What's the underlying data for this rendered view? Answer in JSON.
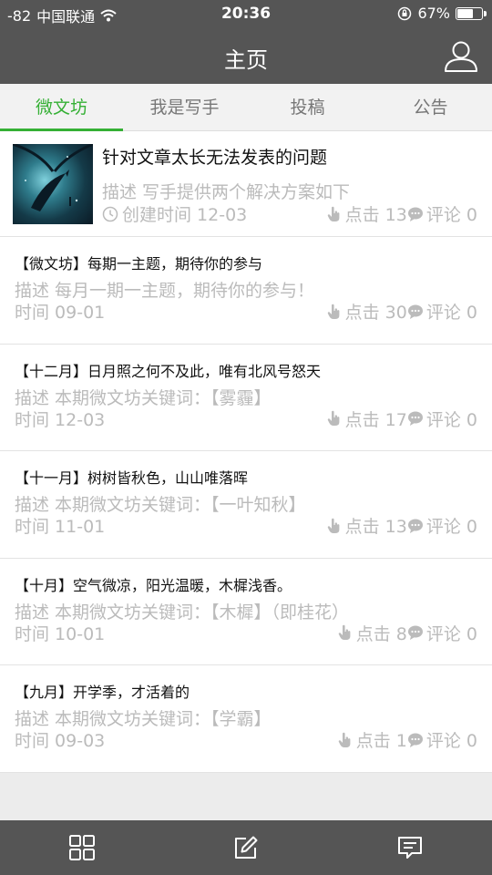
{
  "status_bar": {
    "signal": "-82",
    "carrier": "中国联通",
    "time": "20:36",
    "battery": "67%",
    "battery_level": 0.67
  },
  "header": {
    "title": "主页"
  },
  "tabs": [
    {
      "label": "微文坊",
      "active": true
    },
    {
      "label": "我是写手",
      "active": false
    },
    {
      "label": "投稿",
      "active": false
    },
    {
      "label": "公告",
      "active": false
    }
  ],
  "featured": {
    "title": "针对文章太长无法发表的问题",
    "desc": "描述 写手提供两个解决方案如下",
    "time": "创建时间 12-03",
    "clicks": "点击 13",
    "comments": "评论 0"
  },
  "items": [
    {
      "title": "【微文坊】每期一主题，期待你的参与",
      "desc": "描述 每月一期一主题，期待你的参与！",
      "time": "时间 09-01",
      "clicks": "点击 30",
      "comments": "评论 0"
    },
    {
      "title": "【十二月】日月照之何不及此，唯有北风号怒天",
      "desc": "描述 本期微文坊关键词：【雾霾】",
      "time": "时间 12-03",
      "clicks": "点击 17",
      "comments": "评论 0"
    },
    {
      "title": "【十一月】树树皆秋色，山山唯落晖",
      "desc": "描述 本期微文坊关键词：【一叶知秋】",
      "time": "时间 11-01",
      "clicks": "点击 13",
      "comments": "评论 0"
    },
    {
      "title": "【十月】空气微凉，阳光温暖，木樨浅香。",
      "desc": "描述 本期微文坊关键词：【木樨】（即桂花）",
      "time": "时间 10-01",
      "clicks": "点击 8",
      "comments": "评论 0"
    },
    {
      "title": "【九月】开学季，才活着的",
      "desc": "描述 本期微文坊关键词：【学霸】",
      "time": "时间 09-03",
      "clicks": "点击 1",
      "comments": "评论 0"
    }
  ],
  "colors": {
    "bar": "#555555",
    "accent": "#35b035",
    "muted_text": "#bbbbbb"
  },
  "icons": {
    "user": "user-icon",
    "grid": "grid-icon",
    "compose": "compose-icon",
    "message": "message-icon"
  }
}
